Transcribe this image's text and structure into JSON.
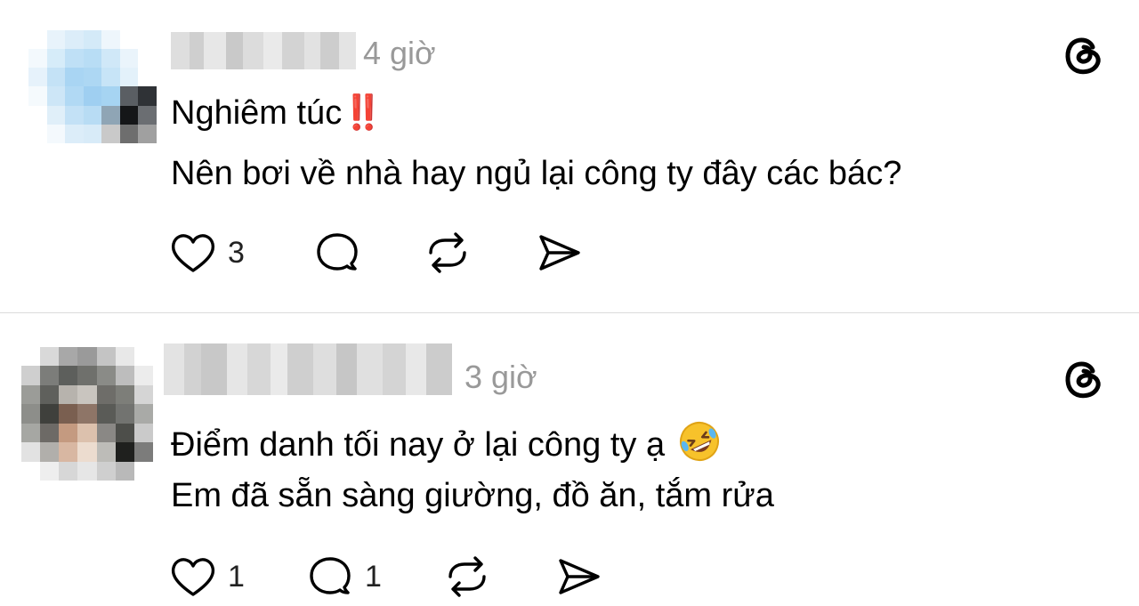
{
  "posts": [
    {
      "time": "4 giờ",
      "line1": "Nghiêm túc",
      "line1_emoji": "‼️",
      "line2": "Nên bơi về nhà hay ngủ lại công ty đây các bác?",
      "like_count": "3",
      "reply_count": "",
      "avatar_colors": [
        "#ffffff",
        "#e8f3fb",
        "#dcedf9",
        "#d4eaf8",
        "#eef6fc",
        "#ffffff",
        "#ffffff",
        "#f3f9fd",
        "#d6ecf9",
        "#bfe0f6",
        "#b8ddf5",
        "#d0e8f8",
        "#eaf4fb",
        "#ffffff",
        "#e6f2fb",
        "#c4e2f6",
        "#a9d5f3",
        "#add7f3",
        "#c7e4f7",
        "#e3f1fa",
        "#ffffff",
        "#f5fafd",
        "#cde6f7",
        "#b1d9f4",
        "#9fcff1",
        "#a6d4f2",
        "#5a5e63",
        "#2f3236",
        "#ffffff",
        "#e0eff9",
        "#c3e1f6",
        "#b8dcf4",
        "#8fa5b5",
        "#151618",
        "#6b6e72",
        "#ffffff",
        "#f4f9fd",
        "#dcedf9",
        "#d8ebf8",
        "#c9c9c9",
        "#6e6e6e",
        "#a0a0a0",
        "#ffffff",
        "#ffffff",
        "#ffffff",
        "#ffffff",
        "#ffffff",
        "#ffffff",
        "#ffffff"
      ]
    },
    {
      "time": "3 giờ",
      "line1": "Điểm danh tối nay ở lại công ty ạ",
      "line1_emoji": "🤣",
      "line2": "Em đã sẵn sàng giường, đồ ăn, tắm rửa",
      "like_count": "1",
      "reply_count": "1",
      "avatar_colors": [
        "#ffffff",
        "#d9d9d9",
        "#a8a8a8",
        "#9a9a9a",
        "#c4c4c4",
        "#e8e8e8",
        "#ffffff",
        "#cfcfcf",
        "#7c7d7a",
        "#5d5f5c",
        "#6f706c",
        "#8a8b87",
        "#bdbdbd",
        "#ececec",
        "#9b9c98",
        "#5f605c",
        "#b7b3ad",
        "#c9c5bf",
        "#6e6d69",
        "#7d7e79",
        "#d5d5d5",
        "#8d8e8a",
        "#3f403c",
        "#7a5f50",
        "#8e7567",
        "#5a5b57",
        "#727370",
        "#a9aaa7",
        "#a6a7a3",
        "#6d6a66",
        "#c49a80",
        "#dcc1ad",
        "#8a8885",
        "#4d4e4a",
        "#cacaca",
        "#e2e2e2",
        "#b1afab",
        "#d8b7a2",
        "#ecdccf",
        "#bdbcb8",
        "#1f201e",
        "#7c7c7b",
        "#ffffff",
        "#eeeeee",
        "#d7d7d7",
        "#e6e6e6",
        "#cfcfcf",
        "#b9b9b9",
        "#ffffff"
      ]
    }
  ],
  "colors": {
    "text": "#000000",
    "muted": "#999999",
    "divider": "#dcdcdc",
    "emphasis_red": "#e1251b"
  },
  "icons": [
    "heart-icon",
    "reply-bubble-icon",
    "repost-icon",
    "share-send-icon",
    "threads-logo-icon"
  ]
}
